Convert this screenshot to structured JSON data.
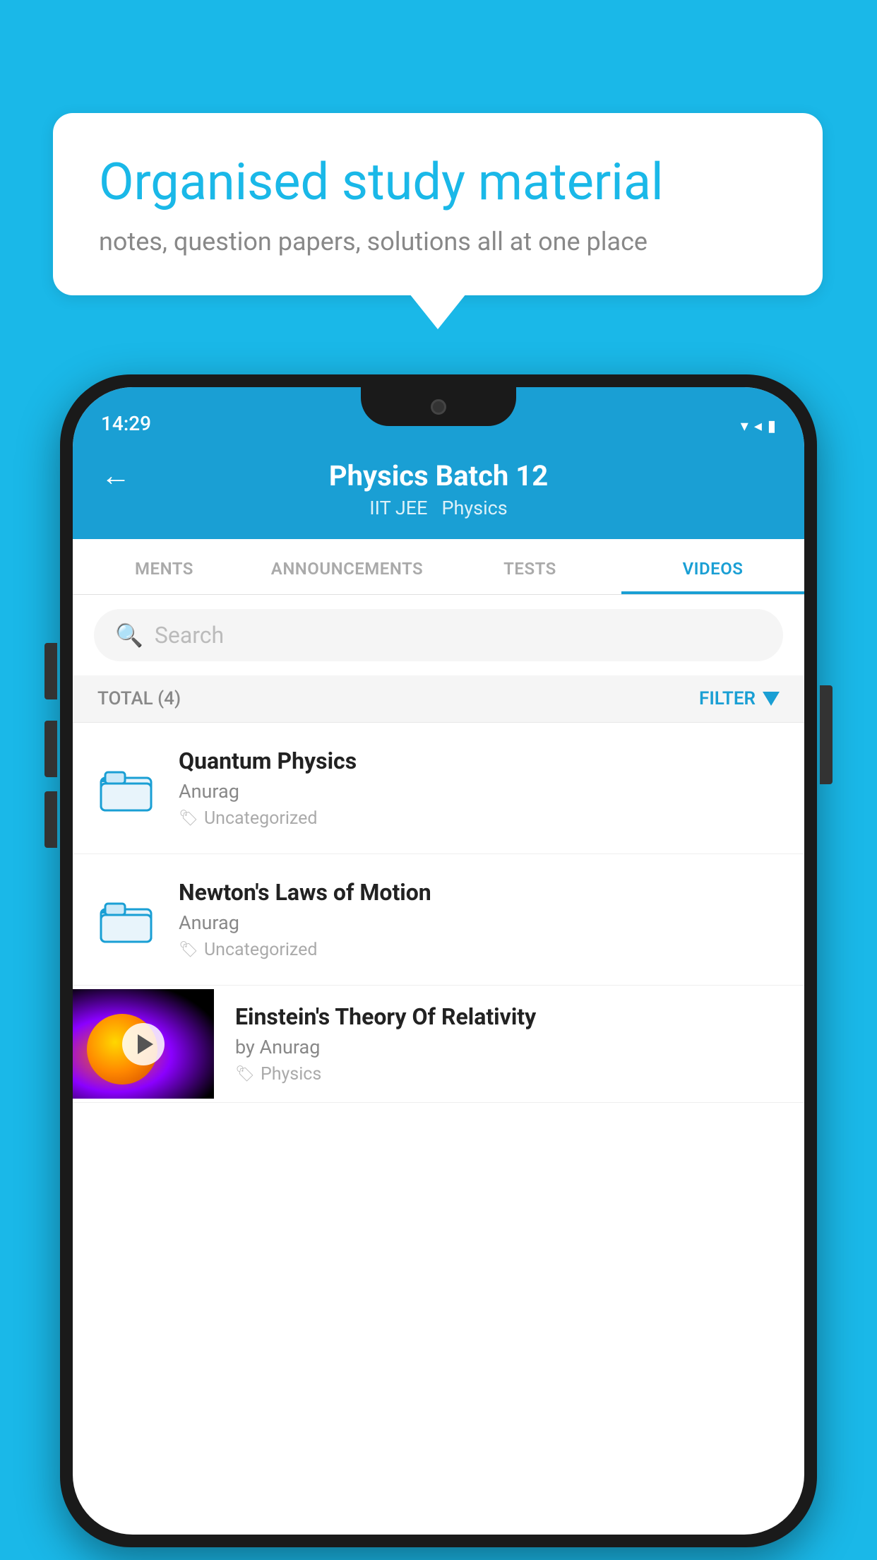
{
  "background_color": "#1ab8e8",
  "speech_bubble": {
    "title": "Organised study material",
    "subtitle": "notes, question papers, solutions all at one place"
  },
  "phone": {
    "status_bar": {
      "time": "14:29",
      "icons": "▾ ◂ ▮"
    },
    "header": {
      "back_label": "←",
      "title": "Physics Batch 12",
      "subtitle_part1": "IIT JEE",
      "subtitle_part2": "Physics"
    },
    "tabs": [
      {
        "label": "MENTS",
        "active": false
      },
      {
        "label": "ANNOUNCEMENTS",
        "active": false
      },
      {
        "label": "TESTS",
        "active": false
      },
      {
        "label": "VIDEOS",
        "active": true
      }
    ],
    "search": {
      "placeholder": "Search"
    },
    "filter_bar": {
      "total_label": "TOTAL (4)",
      "filter_label": "FILTER"
    },
    "videos": [
      {
        "id": 1,
        "title": "Quantum Physics",
        "author": "Anurag",
        "tag": "Uncategorized",
        "has_thumbnail": false
      },
      {
        "id": 2,
        "title": "Newton's Laws of Motion",
        "author": "Anurag",
        "tag": "Uncategorized",
        "has_thumbnail": false
      },
      {
        "id": 3,
        "title": "Einstein's Theory Of Relativity",
        "author": "by Anurag",
        "tag": "Physics",
        "has_thumbnail": true
      }
    ]
  }
}
